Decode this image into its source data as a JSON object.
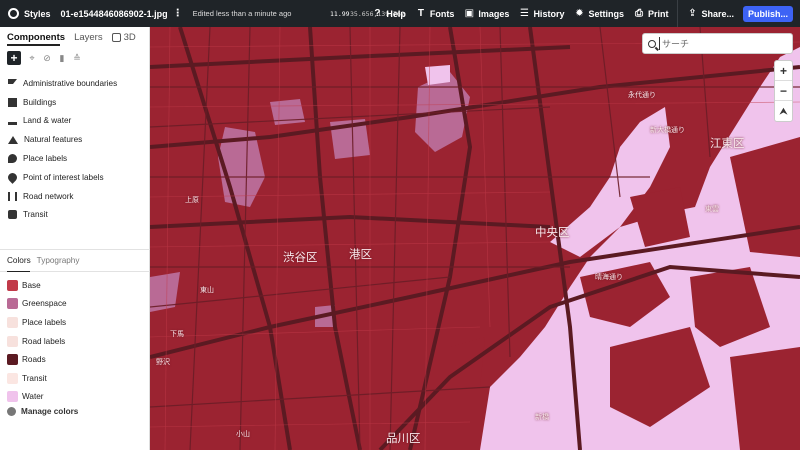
{
  "topbar": {
    "styles_label": "Styles",
    "filename": "01-e1544846086902-1.jpg",
    "more_menu": "⋮",
    "edited_status": "Edited less than a minute ago",
    "zoom_level": "11.99",
    "coordinates": "35.656,139.762",
    "help": "Help",
    "fonts": "Fonts",
    "images": "Images",
    "history": "History",
    "settings": "Settings",
    "print": "Print",
    "share": "Share...",
    "publish": "Publish..."
  },
  "sidebar": {
    "tabs": [
      "Components",
      "Layers",
      "3D"
    ],
    "components": [
      {
        "label": "Administrative boundaries",
        "icon": "boundary-icon"
      },
      {
        "label": "Buildings",
        "icon": "building-icon"
      },
      {
        "label": "Land & water",
        "icon": "land-water-icon"
      },
      {
        "label": "Natural features",
        "icon": "mountain-icon"
      },
      {
        "label": "Place labels",
        "icon": "place-label-icon"
      },
      {
        "label": "Point of interest labels",
        "icon": "poi-icon"
      },
      {
        "label": "Road network",
        "icon": "road-icon"
      },
      {
        "label": "Transit",
        "icon": "transit-icon"
      }
    ],
    "color_tabs": [
      "Colors",
      "Typography"
    ],
    "colors": [
      {
        "label": "Base",
        "color": "#c13a49"
      },
      {
        "label": "Greenspace",
        "color": "#b96a95"
      },
      {
        "label": "Place labels",
        "color": "#f7e1dd"
      },
      {
        "label": "Road labels",
        "color": "#f7e1dd"
      },
      {
        "label": "Roads",
        "color": "#5b1a22"
      },
      {
        "label": "Transit",
        "color": "#fbe6e2"
      },
      {
        "label": "Water",
        "color": "#f0c3ec"
      }
    ],
    "manage_colors": "Manage colors"
  },
  "map": {
    "search_placeholder": "サーチ",
    "zoom_in": "+",
    "zoom_out": "−",
    "compass": "⮝",
    "labels": {
      "shibuya": "渋谷区",
      "minato": "港区",
      "chuo": "中央区",
      "koto": "江東区",
      "shinagawa": "品川区",
      "kami": "上原",
      "higashi": "東山",
      "shimouma": "下馬",
      "nozawa": "野沢",
      "kosan": "小山",
      "nagatacho": "永代通り",
      "shinohashi": "新大橋通り",
      "shinonome": "東雲",
      "kachidoki": "晴海通り",
      "shinbashi": "新橋"
    }
  }
}
